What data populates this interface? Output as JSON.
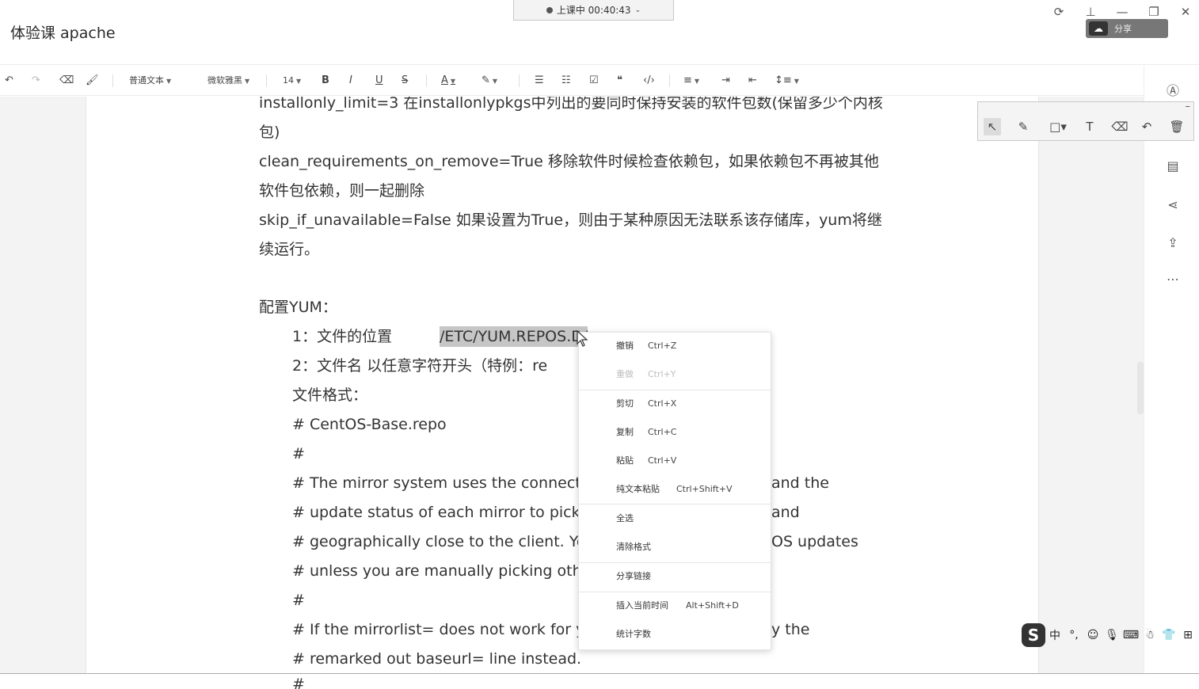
{
  "window": {
    "title": "体验课 apache",
    "live_status": "上课中 00:40:43",
    "cloud_button": "分享"
  },
  "toolbar": {
    "paragraph_style": "普通文本",
    "font_family": "微软雅黑",
    "font_size": "14"
  },
  "document": {
    "lines": [
      "installonly_limit=3  在installonlypkgs中列出的要同时保持安装的软件包数(保留多少个内核",
      "包)",
      "clean_requirements_on_remove=True  移除软件时候检查依赖包，如果依赖包不再被其他",
      "软件包依赖，则一起删除",
      "skip_if_unavailable=False  如果设置为True，则由于某种原因无法联系该存储库，yum将继",
      "续运行。",
      "配置YUM："
    ],
    "item1_label": "1：文件的位置",
    "item1_path": "/ETC/YUM.REPOS.D/",
    "item2": "2：文件名    以任意字符开头（特例：re",
    "format_label": "文件格式：",
    "code": [
      "# CentOS-Base.repo",
      "#",
      "# The mirror system uses the connectir",
      "# update status of each mirror to pick n",
      "# geographically close to the client.  Yo",
      "# unless you are manually picking othe",
      "#",
      "# If the mirrorlist= does not work for yo",
      "# remarked out baseurl= line instead."
    ],
    "code_tail": [
      "and the",
      "and",
      "OS updates",
      "",
      "",
      "y the"
    ],
    "last_line": "#"
  },
  "context_menu": {
    "items": [
      {
        "label": "撤销",
        "shortcut": "Ctrl+Z",
        "enabled": true
      },
      {
        "label": "重做",
        "shortcut": "Ctrl+Y",
        "enabled": false
      },
      {
        "label": "剪切",
        "shortcut": "Ctrl+X",
        "enabled": true
      },
      {
        "label": "复制",
        "shortcut": "Ctrl+C",
        "enabled": true
      },
      {
        "label": "粘贴",
        "shortcut": "Ctrl+V",
        "enabled": true
      },
      {
        "label": "纯文本粘贴",
        "shortcut": "Ctrl+Shift+V",
        "enabled": true
      },
      {
        "label": "全选",
        "shortcut": "",
        "enabled": true
      },
      {
        "label": "清除格式",
        "shortcut": "",
        "enabled": true
      },
      {
        "label": "分享链接",
        "shortcut": "",
        "enabled": true
      },
      {
        "label": "插入当前时间",
        "shortcut": "Alt+Shift+D",
        "enabled": true
      },
      {
        "label": "统计字数",
        "shortcut": "",
        "enabled": true
      }
    ]
  },
  "ime": {
    "mode": "中",
    "punct": "°,"
  }
}
